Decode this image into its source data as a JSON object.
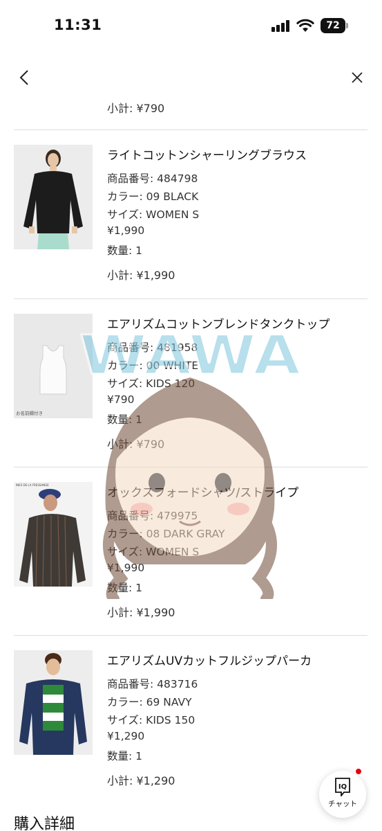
{
  "status_bar": {
    "time": "11:31",
    "battery": "72"
  },
  "cart": {
    "previous_subtotal": "小計: ¥790",
    "items": [
      {
        "name": "ライトコットンシャーリングブラウス",
        "product_number": "商品番号: 484798",
        "color": "カラー: 09 BLACK",
        "size": "サイズ: WOMEN S",
        "price": "¥1,990",
        "quantity": "数量: 1",
        "subtotal": "小計: ¥1,990"
      },
      {
        "name": "エアリズムコットンブレンドタンクトップ",
        "product_number": "商品番号: 481958",
        "color": "カラー: 00 WHITE",
        "size": "サイズ: KIDS 120",
        "price": "¥790",
        "quantity": "数量: 1",
        "subtotal": "小計: ¥790",
        "image_caption": "お名前欄付き"
      },
      {
        "name": "オックスフォードシャツ/ストライプ",
        "product_number": "商品番号: 479975",
        "color": "カラー: 08 DARK GRAY",
        "size": "サイズ: WOMEN S",
        "price": "¥1,990",
        "quantity": "数量: 1",
        "subtotal": "小計: ¥1,990",
        "image_tag": "INES DE LA FRESSANGE"
      },
      {
        "name": "エアリズムUVカットフルジップパーカ",
        "product_number": "商品番号: 483716",
        "color": "カラー: 69 NAVY",
        "size": "サイズ: KIDS 150",
        "price": "¥1,290",
        "quantity": "数量: 1",
        "subtotal": "小計: ¥1,290"
      }
    ]
  },
  "section_title": "購入詳細",
  "chat": {
    "logo": "IQ",
    "label": "チャット"
  },
  "watermark": {
    "text": "WAWA"
  },
  "colors": {
    "divider": "#dcdcdc",
    "badge": "#e60012",
    "text": "#333333"
  }
}
